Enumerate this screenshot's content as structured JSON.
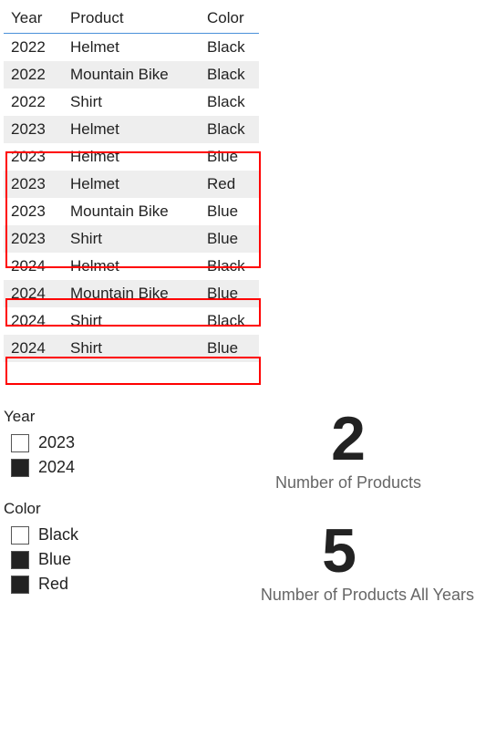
{
  "table": {
    "headers": {
      "year": "Year",
      "product": "Product",
      "color": "Color"
    },
    "rows": [
      {
        "year": "2022",
        "product": "Helmet",
        "color": "Black"
      },
      {
        "year": "2022",
        "product": "Mountain Bike",
        "color": "Black"
      },
      {
        "year": "2022",
        "product": "Shirt",
        "color": "Black"
      },
      {
        "year": "2023",
        "product": "Helmet",
        "color": "Black"
      },
      {
        "year": "2023",
        "product": "Helmet",
        "color": "Blue"
      },
      {
        "year": "2023",
        "product": "Helmet",
        "color": "Red"
      },
      {
        "year": "2023",
        "product": "Mountain Bike",
        "color": "Blue"
      },
      {
        "year": "2023",
        "product": "Shirt",
        "color": "Blue"
      },
      {
        "year": "2024",
        "product": "Helmet",
        "color": "Black"
      },
      {
        "year": "2024",
        "product": "Mountain Bike",
        "color": "Blue"
      },
      {
        "year": "2024",
        "product": "Shirt",
        "color": "Black"
      },
      {
        "year": "2024",
        "product": "Shirt",
        "color": "Blue"
      }
    ]
  },
  "slicers": {
    "year": {
      "title": "Year",
      "items": [
        {
          "label": "2023",
          "selected": false
        },
        {
          "label": "2024",
          "selected": true
        }
      ]
    },
    "color": {
      "title": "Color",
      "items": [
        {
          "label": "Black",
          "selected": false
        },
        {
          "label": "Blue",
          "selected": true
        },
        {
          "label": "Red",
          "selected": true
        }
      ]
    }
  },
  "metrics": {
    "products": {
      "value": "2",
      "label": "Number of Products"
    },
    "products_all_years": {
      "value": "5",
      "label": "Number of Products All Years"
    }
  }
}
